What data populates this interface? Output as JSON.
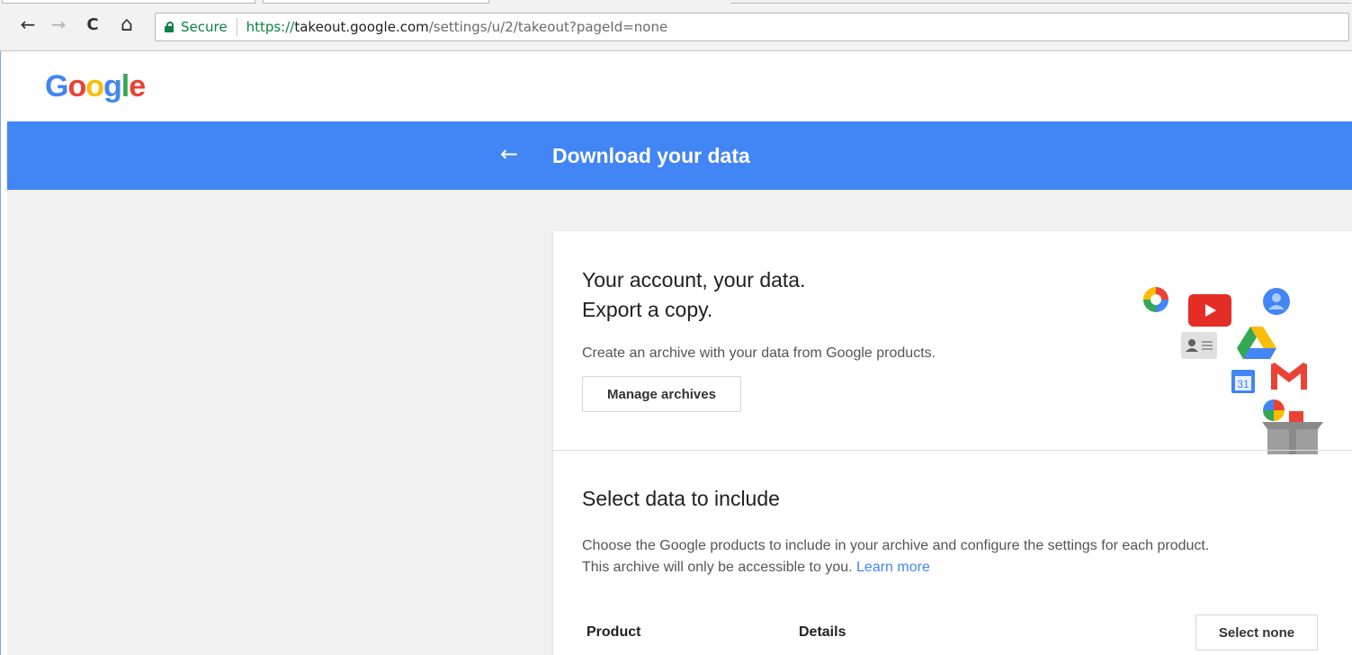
{
  "browser": {
    "nav": {
      "back": "←",
      "forward": "→",
      "reload": "C",
      "home": "⌂"
    },
    "security_label": "Secure",
    "url": {
      "scheme": "https://",
      "host": "takeout.google.com",
      "path": "/settings/u/2/takeout?pageId=none"
    }
  },
  "header": {
    "logo": [
      "G",
      "o",
      "o",
      "g",
      "l",
      "e"
    ]
  },
  "bar": {
    "back": "←",
    "title": "Download your data"
  },
  "intro": {
    "headline_line1": "Your account, your data.",
    "headline_line2": "Export a copy.",
    "subtext": "Create an archive with your data from Google products.",
    "manage_button": "Manage archives"
  },
  "select": {
    "title": "Select data to include",
    "desc_line1": "Choose the Google products to include in your archive and configure the settings for each product.",
    "desc_line2": "This archive will only be accessible to you.",
    "learn_more": "Learn more",
    "col_product": "Product",
    "col_details": "Details",
    "select_none_button": "Select none"
  },
  "illustration": {
    "icons": [
      "photos-icon",
      "youtube-icon",
      "profile-icon",
      "contacts-icon",
      "drive-icon",
      "calendar-icon",
      "gmail-icon",
      "hangouts-icon",
      "archive-box-icon"
    ],
    "calendar_day": "31",
    "colors": {
      "red": "#ea4335",
      "blue": "#4285f4",
      "green": "#34a853",
      "yellow": "#fbbc05"
    }
  }
}
